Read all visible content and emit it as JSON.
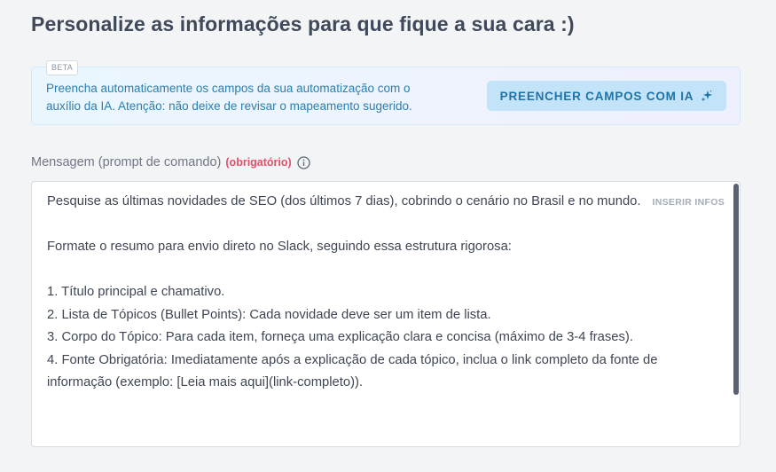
{
  "page": {
    "title": "Personalize as informações para que fique a sua cara :)"
  },
  "ai_banner": {
    "badge": "BETA",
    "text": "Preencha automaticamente os campos da sua automatização com o auxílio da IA. Atenção: não deixe de revisar o mapeamento sugerido.",
    "button_label": "PREENCHER CAMPOS COM IA",
    "button_icon": "sparkle-icon",
    "accent_color": "#1f73a6"
  },
  "message_field": {
    "label": "Mensagem (prompt de comando)",
    "required_label": "(obrigatório)",
    "info_icon": "info-icon",
    "insert_label": "INSERIR INFOS",
    "value": "Pesquise as últimas novidades de SEO (dos últimos 7 dias), cobrindo o cenário no Brasil e no mundo.\n\nFormate o resumo para envio direto no Slack, seguindo essa estrutura rigorosa:\n\n1. Título principal e chamativo.\n2. Lista de Tópicos (Bullet Points): Cada novidade deve ser um item de lista.\n3. Corpo do Tópico: Para cada item, forneça uma explicação clara e concisa (máximo de 3-4 frases).\n4. Fonte Obrigatória: Imediatamente após a explicação de cada tópico, inclua o link completo da fonte de informação (exemplo: [Leia mais aqui](link-completo))."
  }
}
